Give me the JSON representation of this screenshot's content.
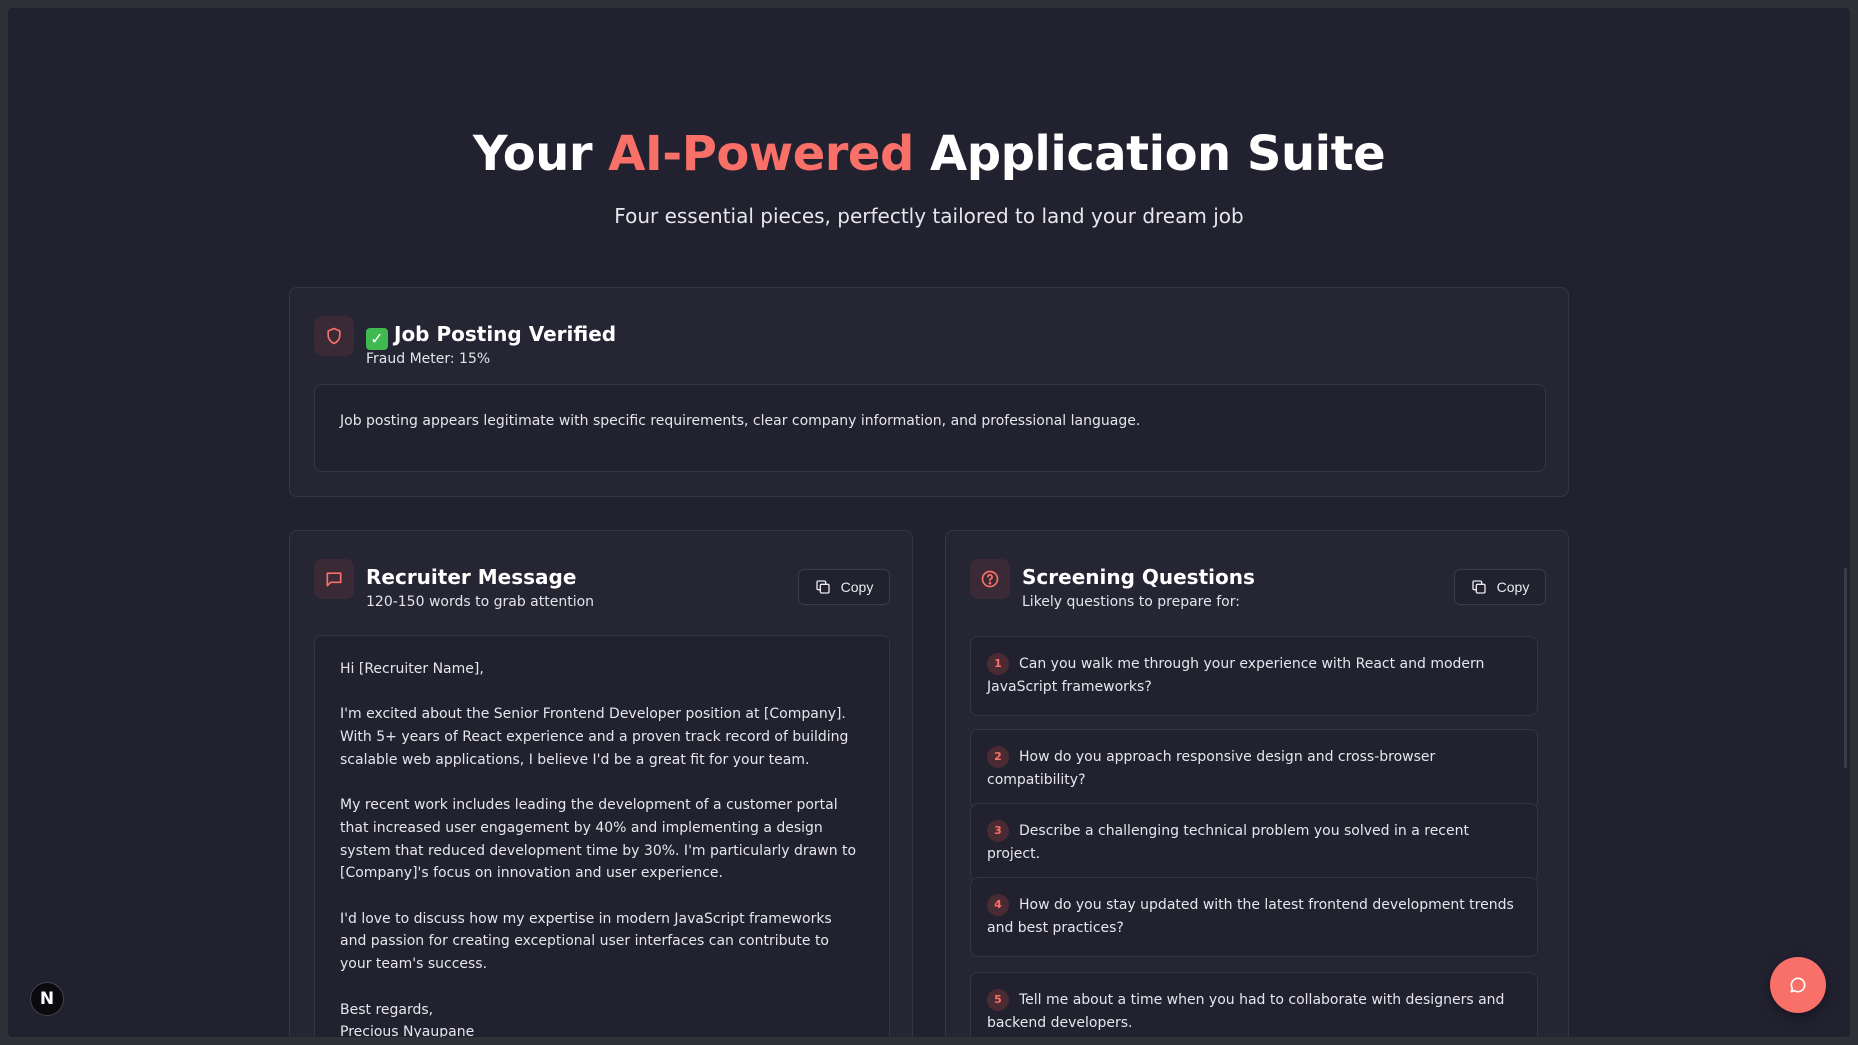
{
  "hero": {
    "title_pre": "Your ",
    "title_accent": "AI-Powered",
    "title_post": " Application Suite",
    "subtitle": "Four essential pieces, perfectly tailored to land your dream job"
  },
  "verification": {
    "emoji": "✓",
    "title": "Job Posting Verified",
    "subtitle": "Fraud Meter: 15%",
    "body": "Job posting appears legitimate with specific requirements, clear company information, and professional language."
  },
  "recruiter": {
    "title": "Recruiter Message",
    "subtitle": "120-150 words to grab attention",
    "copy_label": "Copy",
    "message": "Hi [Recruiter Name],\n\nI'm excited about the Senior Frontend Developer position at [Company]. With 5+ years of React experience and a proven track record of building scalable web applications, I believe I'd be a great fit for your team.\n\nMy recent work includes leading the development of a customer portal that increased user engagement by 40% and implementing a design system that reduced development time by 30%. I'm particularly drawn to [Company]'s focus on innovation and user experience.\n\nI'd love to discuss how my expertise in modern JavaScript frameworks and passion for creating exceptional user interfaces can contribute to your team's success.\n\nBest regards,\nPrecious Nyaupane"
  },
  "screening": {
    "title": "Screening Questions",
    "subtitle": "Likely questions to prepare for:",
    "copy_label": "Copy",
    "questions": [
      {
        "num": "1",
        "text": "Can you walk me through your experience with React and modern JavaScript frameworks?"
      },
      {
        "num": "2",
        "text": "How do you approach responsive design and cross-browser compatibility?"
      },
      {
        "num": "3",
        "text": "Describe a challenging technical problem you solved in a recent project."
      },
      {
        "num": "4",
        "text": "How do you stay updated with the latest frontend development trends and best practices?"
      },
      {
        "num": "5",
        "text": "Tell me about a time when you had to collaborate with designers and backend developers."
      }
    ]
  },
  "badge": {
    "letter": "N"
  },
  "colors": {
    "accent": "#f87068",
    "background": "#212130",
    "card": "#252534"
  }
}
